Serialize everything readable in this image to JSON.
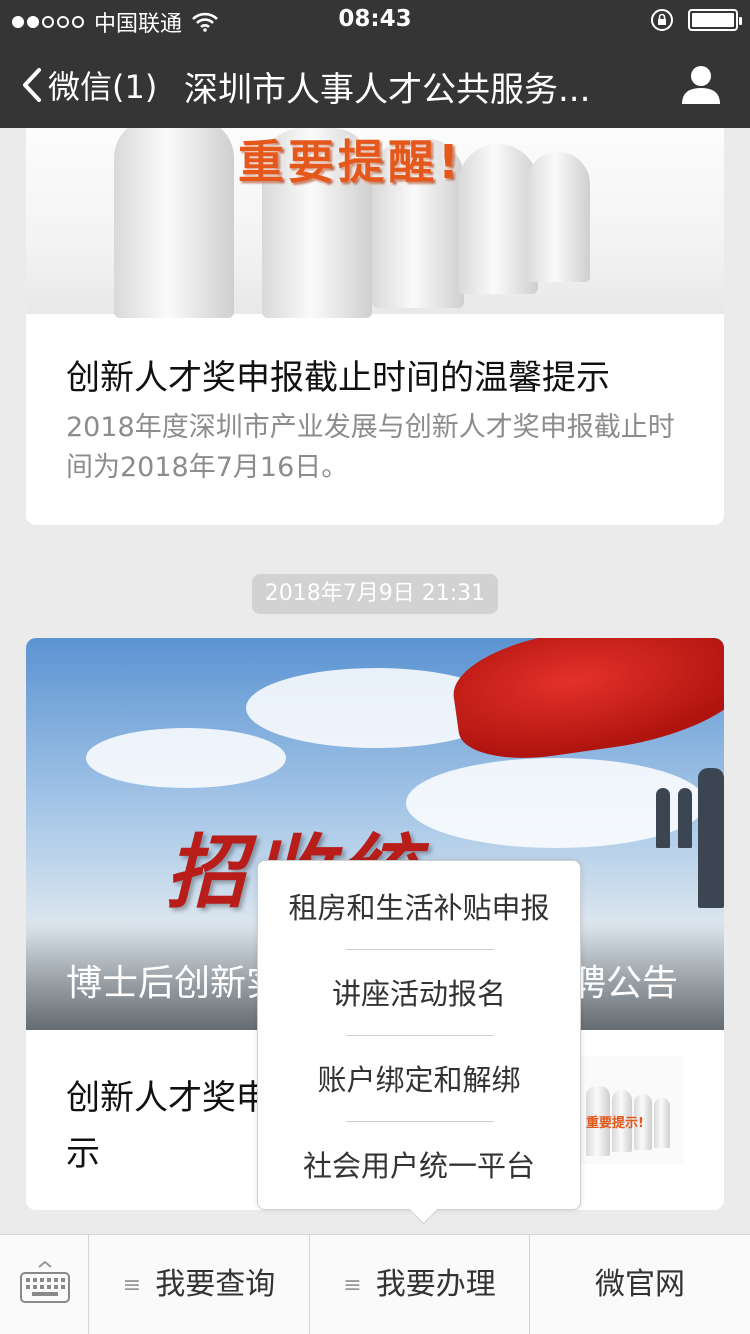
{
  "status_bar": {
    "carrier": "中国联通",
    "time": "08:43",
    "signal_dots_on": 2,
    "signal_dots_total": 5,
    "battery_level": 1.0
  },
  "nav": {
    "back_label": "微信(1)",
    "title": "深圳市人事人才公共服务...",
    "back_icon": "chevron-left-icon",
    "profile_icon": "person-icon"
  },
  "article1": {
    "banner_text": "重要提醒!",
    "title": "创新人才奖申报截止时间的温馨提示",
    "description": "2018年度深圳市产业发展与创新人才奖申报截止时间为2018年7月16日。"
  },
  "timestamp": "2018年7月9日 21:31",
  "article2": {
    "banner_text": "招收统一",
    "overlay_title": "博士后创新实践基地招收统一招聘公告",
    "title": "创新人才奖申报截止时间的温馨提示",
    "thumb_text": "重要提示!"
  },
  "popup_menu": {
    "items": [
      "租房和生活补贴申报",
      "讲座活动报名",
      "账户绑定和解绑",
      "社会用户统一平台"
    ]
  },
  "bottom_bar": {
    "keyboard_icon": "keyboard-icon",
    "tabs": [
      "我要查询",
      "我要办理",
      "微官网"
    ],
    "menu_glyph": "≡"
  },
  "colors": {
    "nav_bg": "#353535",
    "page_bg": "#ebebeb",
    "accent_orange": "#e4581c",
    "flag_red": "#c81e18"
  }
}
